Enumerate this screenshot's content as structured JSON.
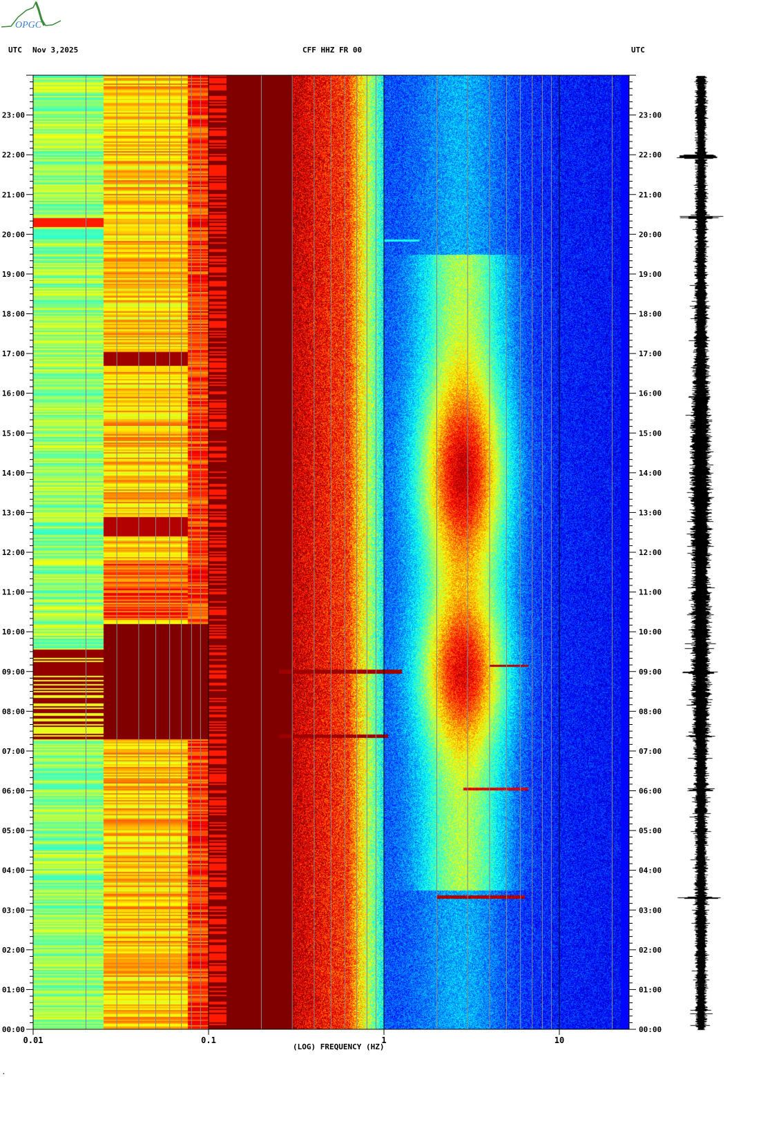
{
  "header": {
    "left_tz": "UTC",
    "date": "Nov 3,2025",
    "station": "CFF HHZ FR 00",
    "right_tz": "UTC",
    "logo_text": "OPGC"
  },
  "chart_data": {
    "type": "heatmap",
    "title": "CFF HHZ FR 00",
    "date": "Nov 3,2025",
    "xlabel": "(LOG) FREQUENCY (HZ)",
    "ylabel": "UTC",
    "x_scale": "log",
    "xlim": [
      0.01,
      25
    ],
    "ylim_hours": [
      0,
      24
    ],
    "x_tick_labels": [
      "0.01",
      "0.1",
      "1",
      "10"
    ],
    "x_tick_values": [
      0.01,
      0.1,
      1,
      10
    ],
    "y_tick_labels": [
      "00:00",
      "01:00",
      "02:00",
      "03:00",
      "04:00",
      "05:00",
      "06:00",
      "07:00",
      "08:00",
      "09:00",
      "10:00",
      "11:00",
      "12:00",
      "13:00",
      "14:00",
      "15:00",
      "16:00",
      "17:00",
      "18:00",
      "19:00",
      "20:00",
      "21:00",
      "22:00",
      "23:00"
    ],
    "colormap": "jet",
    "events": [
      {
        "time_h": 3.33,
        "freq_range_hz": [
          2,
          6
        ]
      },
      {
        "time_h": 6.05,
        "freq_range_hz": [
          3,
          6.5
        ]
      },
      {
        "time_h": 7.38,
        "freq_range_hz": [
          0.25,
          1
        ]
      },
      {
        "time_h": 9.0,
        "freq_range_hz": [
          0.25,
          1.3
        ]
      },
      {
        "time_h": 19.85,
        "freq_range_hz": [
          0.9,
          1.6
        ]
      }
    ],
    "microseism_band_hz": [
      0.1,
      0.3
    ],
    "noise_band_hz": [
      1.5,
      5
    ]
  },
  "footer": {
    "mark": "·"
  }
}
